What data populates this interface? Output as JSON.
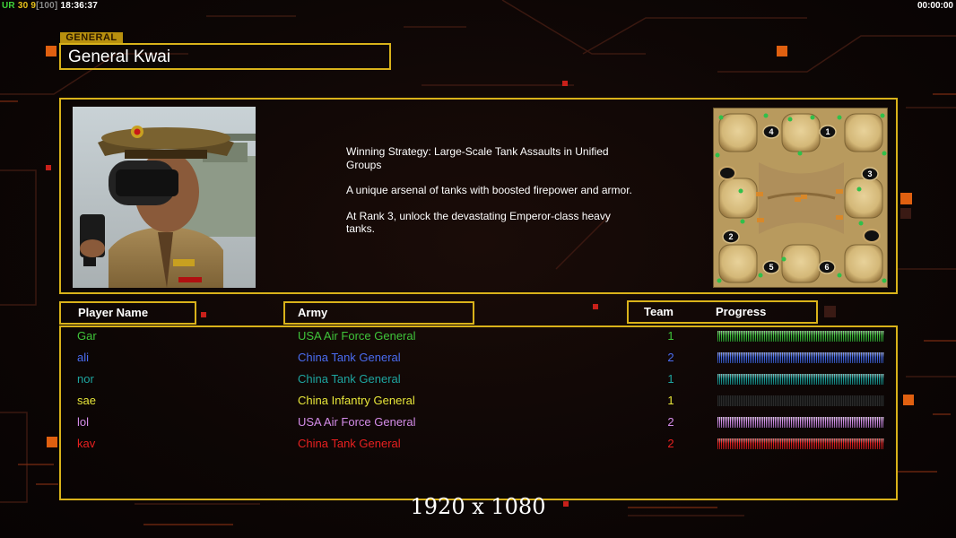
{
  "hud": {
    "ur_label": "UR",
    "stats": "30 9",
    "bracket_value": "[100]",
    "clock": "18:36:37",
    "game_timer": "00:00:00"
  },
  "general": {
    "tag": "GENERAL",
    "name": "General Kwai"
  },
  "strategy": {
    "line1": "Winning Strategy: Large-Scale Tank Assaults in Unified Groups",
    "line2": "A unique arsenal of tanks with boosted firepower and armor.",
    "line3": "At Rank 3, unlock the devastating Emperor-class heavy tanks."
  },
  "map": {
    "start_positions": [
      "4",
      "1",
      "3",
      "2",
      "5",
      "6"
    ]
  },
  "headers": {
    "player_name": "Player Name",
    "army": "Army",
    "team": "Team",
    "progress": "Progress"
  },
  "players": [
    {
      "name": "Gar",
      "army": "USA Air Force General",
      "team": "1",
      "color": "#3fc43a",
      "progress": 1.0
    },
    {
      "name": "ali",
      "army": "China Tank General",
      "team": "2",
      "color": "#4a6cf0",
      "progress": 1.0
    },
    {
      "name": "nor",
      "army": "China Tank General",
      "team": "1",
      "color": "#1ea5a0",
      "progress": 1.0
    },
    {
      "name": "sae",
      "army": "China Infantry General",
      "team": "1",
      "color": "#e8e63a",
      "progress": 0.0
    },
    {
      "name": "lol",
      "army": "USA Air Force General",
      "team": "2",
      "color": "#d48ce8",
      "progress": 1.0
    },
    {
      "name": "kav",
      "army": "China Tank General",
      "team": "2",
      "color": "#e82020",
      "progress": 1.0
    }
  ],
  "resolution": "1920 x 1080"
}
